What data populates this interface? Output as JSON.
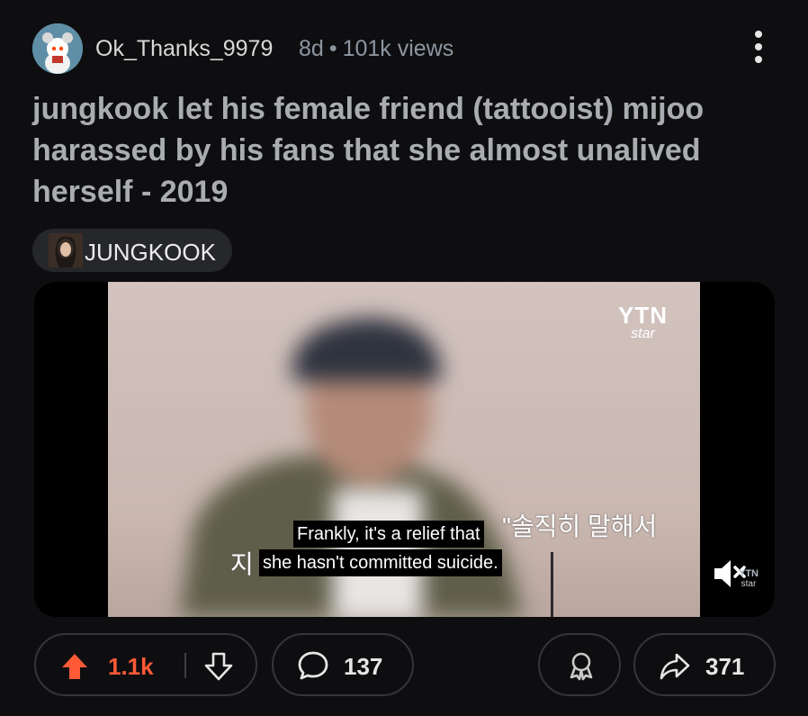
{
  "post": {
    "username": "Ok_Thanks_9979",
    "age": "8d",
    "separator": "•",
    "views": "101k views",
    "title": "jungkook let his female friend (tattooist) mijoo harassed by his fans that she almost unalived herself - 2019",
    "flair": "JUNGKOOK"
  },
  "video": {
    "logo_top": "YTN",
    "logo_sub": "star",
    "korean_line1": "\"솔직히 말해서",
    "korean_line2": "지                           이에요\"",
    "subtitle_line1": "Frankly, it's a relief that",
    "subtitle_line2": "she hasn't committed suicide.",
    "watermark_top": "YTN",
    "watermark_sub": "star"
  },
  "actions": {
    "upvotes": "1.1k",
    "comments": "137",
    "shares": "371"
  },
  "colors": {
    "background": "#0e0e10",
    "upvote": "#ff5a36",
    "title": "#a9acb1",
    "meta": "#8d96a0"
  }
}
